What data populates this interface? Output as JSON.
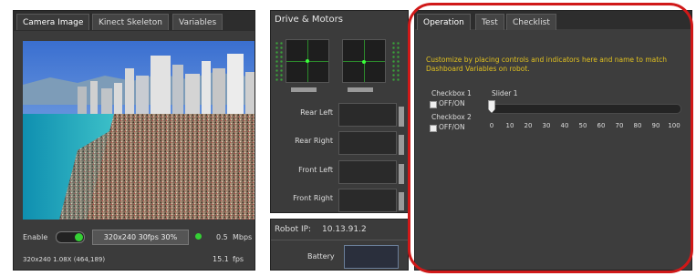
{
  "camera_panel": {
    "tabs": [
      "Camera Image",
      "Kinect Skeleton",
      "Variables"
    ],
    "enable_label": "Enable",
    "format_button": "320x240  30fps  30%",
    "bandwidth": "0.5",
    "bandwidth_unit": "Mbps",
    "resolution_info": "320x240 1.08X  (464,189)",
    "fps_value": "15.1",
    "fps_unit": "fps"
  },
  "drive_panel": {
    "title": "Drive & Motors",
    "motors": [
      "Rear Left",
      "Rear Right",
      "Front Left",
      "Front Right"
    ]
  },
  "robot_panel": {
    "ip_label": "Robot IP:",
    "ip_value": "10.13.91.2",
    "battery_label": "Battery"
  },
  "operation_panel": {
    "tabs": [
      "Operation",
      "Test",
      "Checklist"
    ],
    "instructions": "Customize by placing controls and indicators here and name to match Dashboard Variables on robot.",
    "checkbox1_label": "Checkbox 1",
    "checkbox1_text": "OFF/ON",
    "checkbox2_label": "Checkbox 2",
    "checkbox2_text": "OFF/ON",
    "slider_label": "Slider 1",
    "slider_ticks": [
      "0",
      "10",
      "20",
      "30",
      "40",
      "50",
      "60",
      "70",
      "80",
      "90",
      "100"
    ],
    "slider_value": 0
  },
  "colors": {
    "highlight_ring": "#d01818",
    "instruction_text": "#e0c020",
    "indicator_green": "#35d035"
  }
}
